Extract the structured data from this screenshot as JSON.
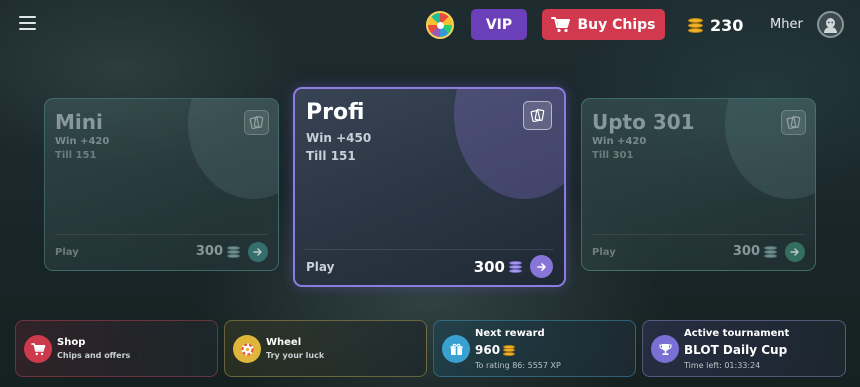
{
  "header": {
    "vip_label": "VIP",
    "buy_chips_label": "Buy Chips",
    "chips_balance": "230",
    "username": "Mher"
  },
  "modes": [
    {
      "title": "Mini",
      "win": "Win +420",
      "till": "Till 151",
      "play": "Play",
      "price": "300",
      "selected": false
    },
    {
      "title": "Profi",
      "win": "Win +450",
      "till": "Till 151",
      "play": "Play",
      "price": "300",
      "selected": true
    },
    {
      "title": "Upto 301",
      "win": "Win +420",
      "till": "Till 301",
      "play": "Play",
      "price": "300",
      "selected": false
    }
  ],
  "tiles": {
    "shop": {
      "title": "Shop",
      "subtitle": "Chips and offers"
    },
    "wheel": {
      "title": "Wheel",
      "subtitle": "Try your luck"
    },
    "reward": {
      "title": "Next reward",
      "amount": "960",
      "rating": "To rating 86: 5557 XP"
    },
    "tournament": {
      "title": "Active tournament",
      "name": "BLOT Daily Cup",
      "time_left": "Time left: 01:33:24"
    }
  },
  "colors": {
    "vip": "#6b3fb8",
    "buy_chips": "#d13a4e",
    "selected_border": "#8c7ce0",
    "coin": "#f0b429"
  },
  "icons": [
    "menu-icon",
    "fortune-wheel-icon",
    "cart-icon",
    "coin-stack-icon",
    "avatar-icon",
    "playing-cards-icon",
    "arrow-right-icon",
    "gift-icon",
    "trophy-icon"
  ]
}
